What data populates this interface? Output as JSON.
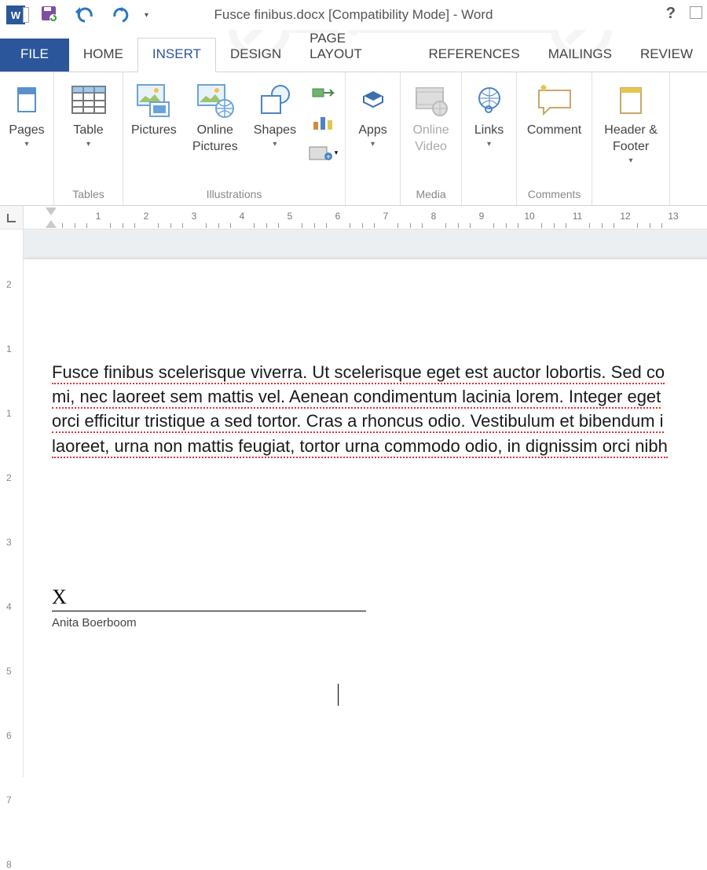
{
  "titlebar": {
    "title": "Fusce finibus.docx [Compatibility Mode] - Word"
  },
  "tabs": {
    "file": "FILE",
    "items": [
      "HOME",
      "INSERT",
      "DESIGN",
      "PAGE LAYOUT",
      "REFERENCES",
      "MAILINGS",
      "REVIEW"
    ],
    "active_index": 1
  },
  "ribbon": {
    "pages": {
      "label": "Pages"
    },
    "tables": {
      "btn": "Table",
      "group": "Tables"
    },
    "illustrations": {
      "group": "Illustrations",
      "pictures": "Pictures",
      "online_pictures": "Online Pictures",
      "shapes": "Shapes"
    },
    "apps": {
      "btn": "Apps"
    },
    "media": {
      "group": "Media",
      "online_video": "Online Video"
    },
    "links": {
      "btn": "Links"
    },
    "comments": {
      "group": "Comments",
      "comment": "Comment"
    },
    "headerfooter": {
      "btn": "Header & Footer"
    }
  },
  "ruler_h": {
    "numbers": [
      "1",
      "2",
      "3",
      "4",
      "5",
      "6",
      "7",
      "8",
      "9",
      "10",
      "11",
      "12",
      "13"
    ]
  },
  "ruler_v": {
    "numbers": [
      "2",
      "1",
      "1",
      "2",
      "3",
      "4",
      "5",
      "6",
      "7",
      "8"
    ]
  },
  "document": {
    "line1": "Fusce finibus scelerisque viverra. Ut scelerisque eget est auctor lobortis. Sed co",
    "line2": "mi, nec laoreet sem mattis vel. Aenean condimentum lacinia lorem. Integer eget",
    "line3": "orci efficitur tristique a sed tortor. Cras a rhoncus odio. Vestibulum et bibendum i",
    "line4": "laoreet, urna non mattis feugiat, tortor urna commodo odio, in dignissim orci nibh",
    "signature": {
      "mark": "X",
      "name": "Anita Boerboom"
    }
  }
}
